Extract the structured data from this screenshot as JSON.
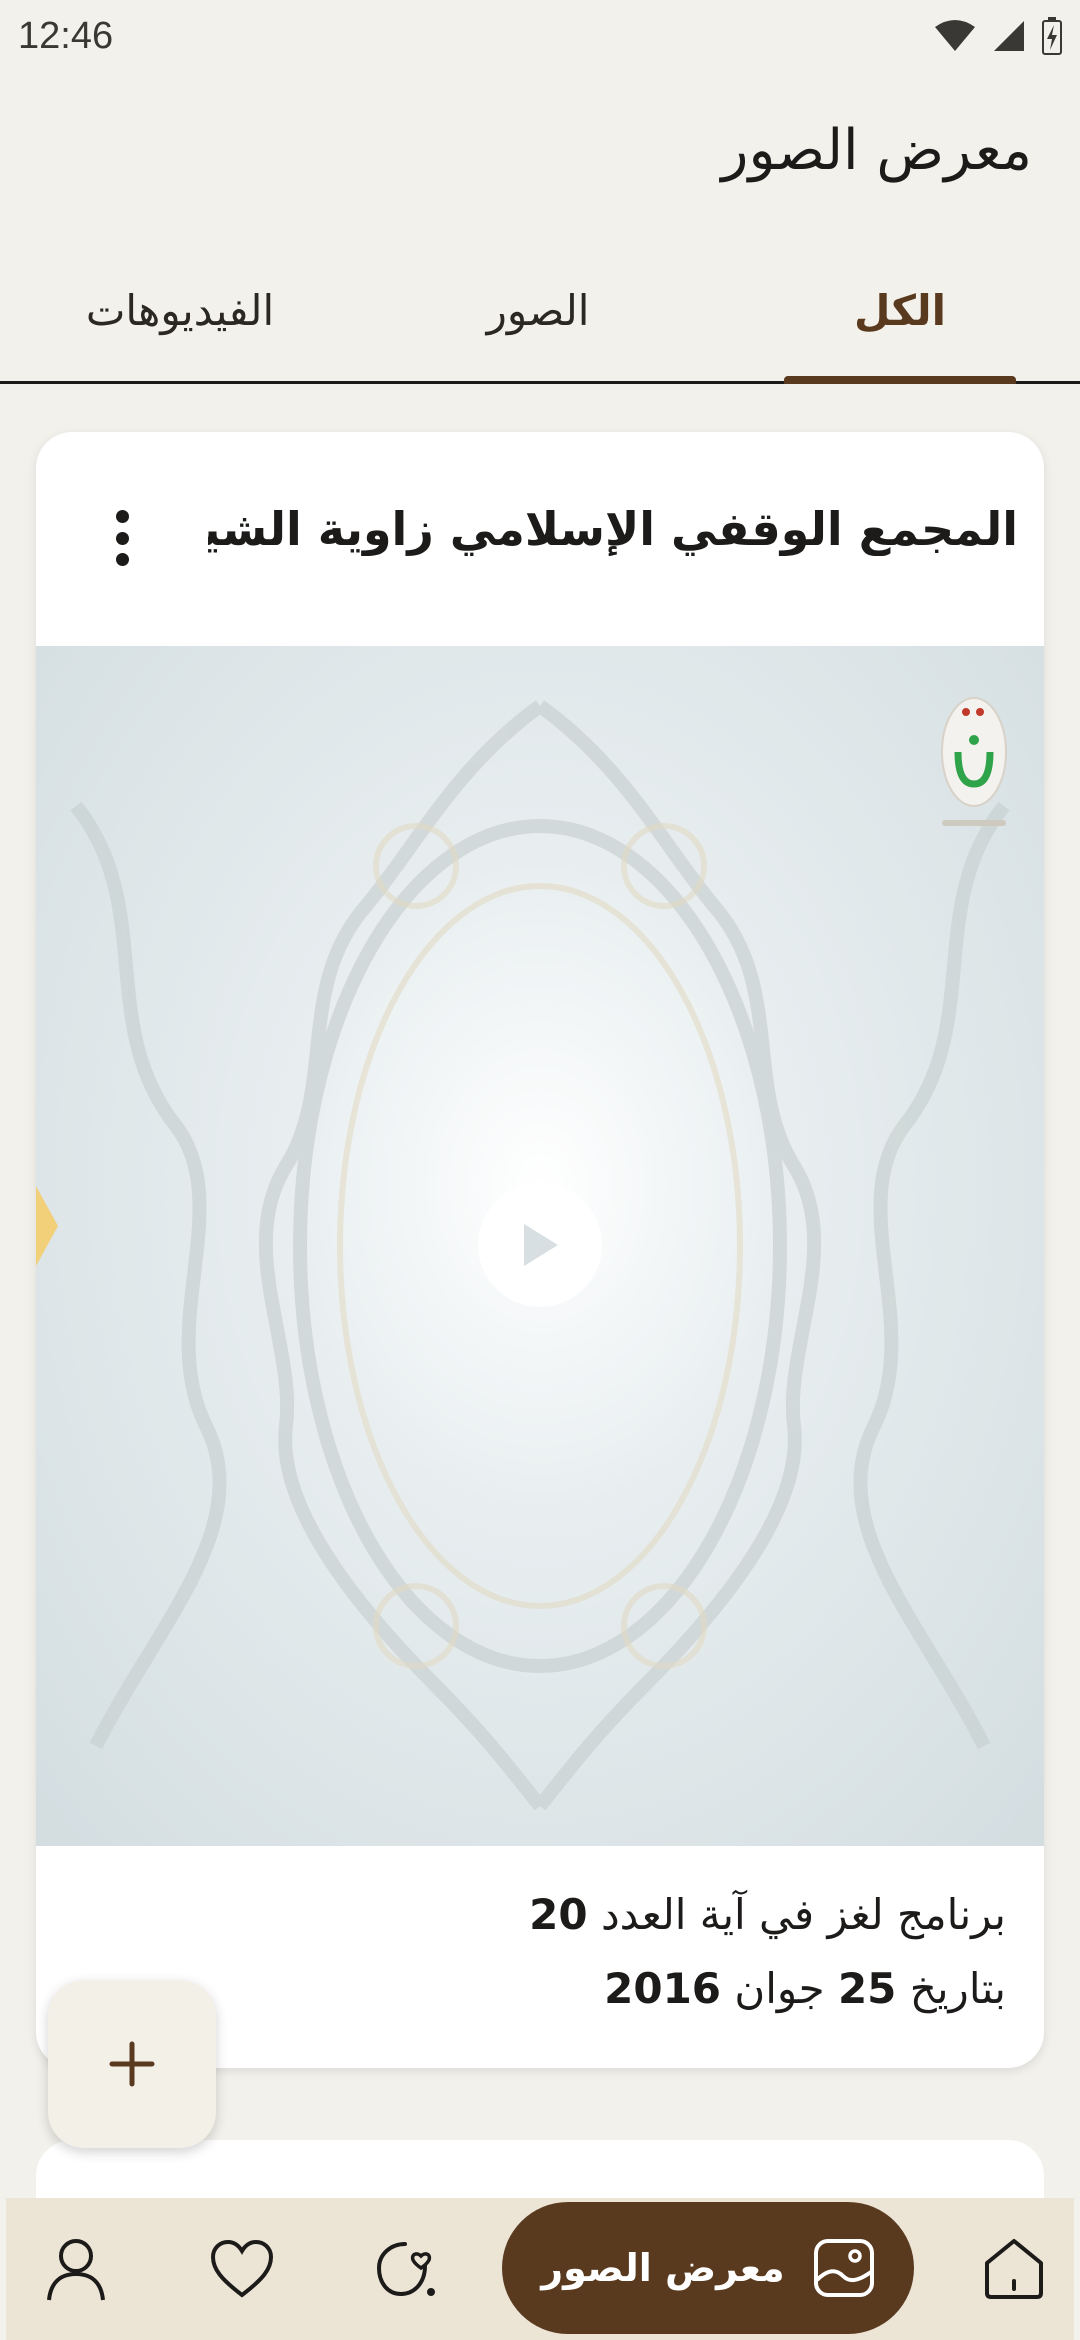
{
  "status": {
    "time": "12:46"
  },
  "app": {
    "title": "معرض الصور"
  },
  "tabs": [
    {
      "label": "الكل",
      "active": true
    },
    {
      "label": "الصور",
      "active": false
    },
    {
      "label": "الفيديوهات",
      "active": false
    }
  ],
  "card": {
    "title": "المجمع الوقفي الإسلامي زاوية الشيخ ...",
    "description_line1_text": "برنامج لغز في آية العدد",
    "description_line1_number": "20",
    "description_line2_prefix": "بتاريخ",
    "description_line2_day": "25",
    "description_line2_month": "جوان",
    "description_line2_year": "2016"
  },
  "bottom_nav": {
    "active_label": "معرض الصور",
    "items": [
      "home-icon",
      "gallery-icon",
      "hands-heart-icon",
      "heart-icon",
      "profile-icon"
    ]
  },
  "colors": {
    "brand": "#5a3a1f",
    "background": "#f3f1ec",
    "nav_background": "#ece5d6"
  }
}
